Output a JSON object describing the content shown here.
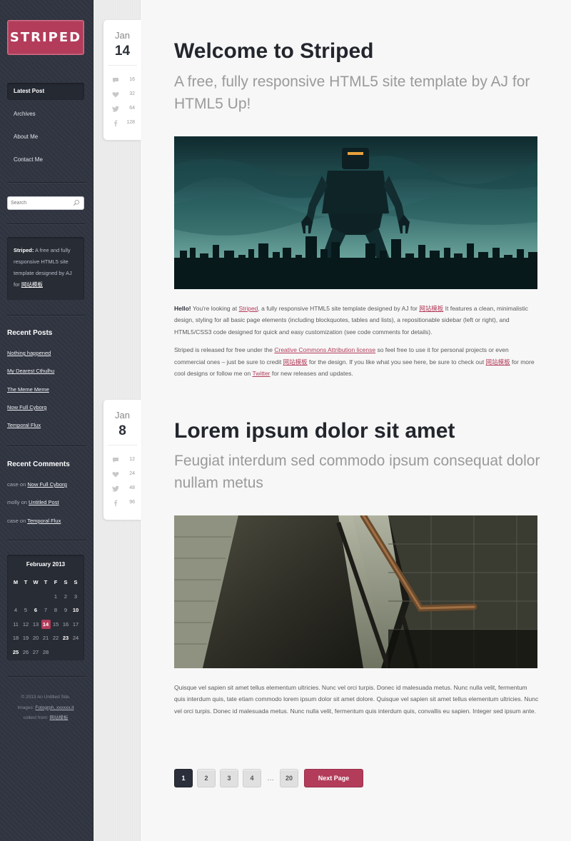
{
  "sidebar": {
    "logo": "STRIPED",
    "nav": [
      {
        "label": "Latest Post",
        "active": true
      },
      {
        "label": "Archives",
        "active": false
      },
      {
        "label": "About Me",
        "active": false
      },
      {
        "label": "Contact Me",
        "active": false
      }
    ],
    "search": {
      "placeholder": "Search"
    },
    "about": {
      "lead": "Striped:",
      "text": " A free and fully responsive HTML5 site template designed by AJ for ",
      "link": "网站模板"
    },
    "recent_posts": {
      "heading": "Recent Posts",
      "items": [
        "Nothing happened",
        "My Dearest Cthulhu",
        "The Meme Meme",
        "Now Full Cyborg",
        "Temporal Flux"
      ]
    },
    "recent_comments": {
      "heading": "Recent Comments",
      "items": [
        {
          "author": "case",
          "on": " on ",
          "post": "Now Full Cyborg"
        },
        {
          "author": "molly",
          "on": " on ",
          "post": "Untitled Post"
        },
        {
          "author": "case",
          "on": " on ",
          "post": "Temporal Flux"
        }
      ]
    },
    "calendar": {
      "title": "February 2013",
      "days": [
        "M",
        "T",
        "W",
        "T",
        "F",
        "S",
        "S"
      ],
      "weeks": [
        [
          "",
          "",
          "",
          "",
          "1",
          "2",
          "3"
        ],
        [
          "4",
          "5",
          "6",
          "7",
          "8",
          "9",
          "10"
        ],
        [
          "11",
          "12",
          "13",
          "14",
          "15",
          "16",
          "17"
        ],
        [
          "18",
          "19",
          "20",
          "21",
          "22",
          "23",
          "24"
        ],
        [
          "25",
          "26",
          "27",
          "28",
          "",
          "",
          ""
        ]
      ],
      "bold_days": [
        "6",
        "10",
        "23",
        "25"
      ],
      "today": "14"
    },
    "footer": {
      "line1": "© 2013 An Untitled Site.",
      "images_label": "Images: ",
      "images_link": "Fotogrph, xxxxxx.it",
      "collect_label": "collect from: ",
      "collect_link": "网站模板"
    }
  },
  "posts": [
    {
      "month": "Jan",
      "day": "14",
      "stats": {
        "comments": "16",
        "likes": "32",
        "tweets": "64",
        "facebook": "128"
      },
      "title": "Welcome to Striped",
      "subtitle": "A free, fully responsive HTML5 site template by AJ for HTML5 Up!",
      "p1": {
        "hello": "Hello!",
        "t1": " You're looking at ",
        "l1": "Striped",
        "t2": ", a fully responsive HTML5 site template designed by AJ for ",
        "l2": "网站模板",
        "t3": " It features a clean, minimalistic design, styling for all basic page elements (including blockquotes, tables and lists), a repositionable sidebar (left or right), and HTML5/CSS3 code designed for quick and easy customization (see code comments for details)."
      },
      "p2": {
        "t1": "Striped is released for free under the ",
        "l1": "Creative Commons Attribution license",
        "t2": " so feel free to use it for personal projects or even commercial ones – just be sure to credit ",
        "l2": "网站模板",
        "t3": " for the design. If you like what you see here, be sure to check out ",
        "l3": "网站模板",
        "t4": " for more cool designs or follow me on ",
        "l4": "Twitter",
        "t5": " for new releases and updates."
      }
    },
    {
      "month": "Jan",
      "day": "8",
      "stats": {
        "comments": "12",
        "likes": "24",
        "tweets": "48",
        "facebook": "96"
      },
      "title": "Lorem ipsum dolor sit amet",
      "subtitle": "Feugiat interdum sed commodo ipsum consequat dolor nullam metus",
      "body": "Quisque vel sapien sit amet tellus elementum ultricies. Nunc vel orci turpis. Donec id malesuada metus. Nunc nulla velit, fermentum quis interdum quis, tate etiam commodo lorem ipsum dolor sit amet dolore. Quisque vel sapien sit amet tellus elementum ultricies. Nunc vel orci turpis. Donec id malesuada metus. Nunc nulla velit, fermentum quis interdum quis, convallis eu sapien. Integer sed ipsum ante."
    }
  ],
  "pager": {
    "pages": [
      "1",
      "2",
      "3",
      "4"
    ],
    "dots": "…",
    "last": "20",
    "current": "1",
    "next_label": "Next Page"
  },
  "colors": {
    "accent": "#b33c5a",
    "sidebar_bg": "#2f3440",
    "ribbon_bg": "#ececec"
  }
}
